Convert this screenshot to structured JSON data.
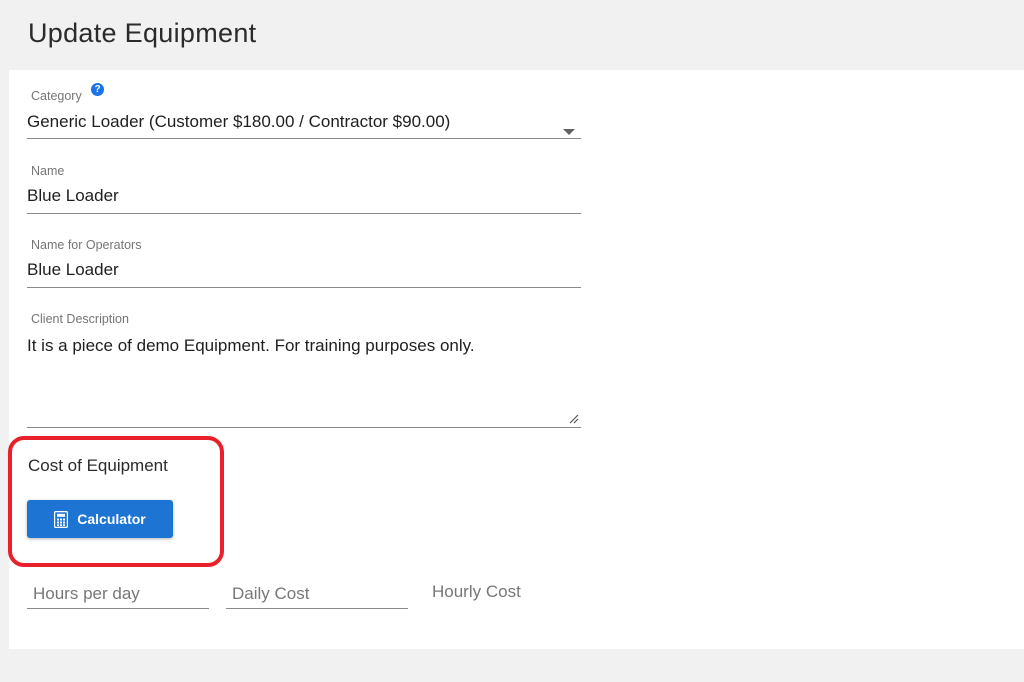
{
  "page": {
    "title": "Update Equipment"
  },
  "form": {
    "category": {
      "label": "Category",
      "value": "Generic Loader (Customer $180.00 / Contractor $90.00)",
      "help_icon": "?"
    },
    "name": {
      "label": "Name",
      "value": "Blue Loader"
    },
    "operator_name": {
      "label": "Name for Operators",
      "value": "Blue Loader"
    },
    "client_description": {
      "label": "Client Description",
      "value": "It is a piece of demo Equipment. For training purposes only."
    }
  },
  "cost": {
    "heading": "Cost of Equipment",
    "calculator_label": "Calculator",
    "hours_per_day_placeholder": "Hours per day",
    "daily_cost_placeholder": "Daily Cost",
    "hourly_cost_label": "Hourly Cost"
  },
  "colors": {
    "accent": "#1e74d3",
    "highlight": "#e8202a",
    "help_icon": "#1a73e8"
  },
  "icons": {
    "help": "question-circle-icon",
    "dropdown": "caret-down-icon",
    "calculator": "calculator-icon",
    "resize": "resize-handle-icon"
  }
}
